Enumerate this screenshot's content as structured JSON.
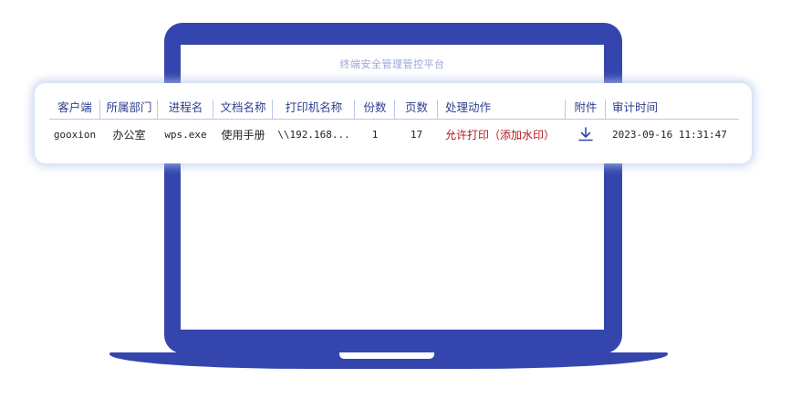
{
  "screen": {
    "title": "终端安全管理管控平台"
  },
  "table": {
    "headers": [
      "客户端",
      "所属部门",
      "进程名",
      "文档名称",
      "打印机名称",
      "份数",
      "页数",
      "处理动作",
      "附件",
      "审计时间"
    ],
    "row": {
      "client": "gooxion",
      "department": "办公室",
      "process": "wps.exe",
      "document": "使用手册",
      "printer": "\\\\192.168...",
      "copies": "1",
      "pages": "17",
      "action": "允许打印（添加水印）",
      "attachment_icon": "download-icon",
      "time": "2023-09-16 11:31:47"
    }
  },
  "colors": {
    "laptop": "#3446ad",
    "header_text": "#2f3f8f",
    "action_text": "#b5161b",
    "divider": "#b9c8ea"
  }
}
